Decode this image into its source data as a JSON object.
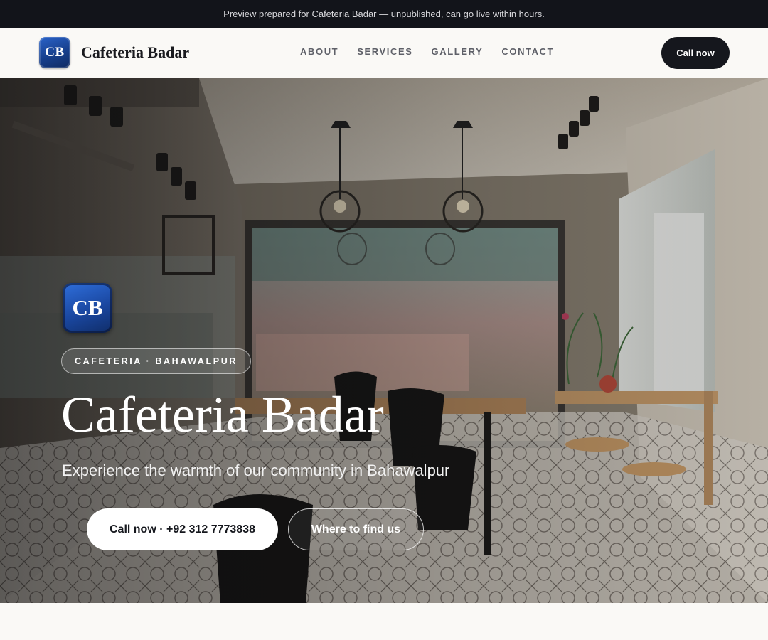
{
  "banner": {
    "text": "Preview prepared for Cafeteria Badar — unpublished, can go live within hours."
  },
  "header": {
    "logo_initials": "CB",
    "brand": "Cafeteria Badar",
    "nav": [
      "ABOUT",
      "SERVICES",
      "GALLERY",
      "CONTACT"
    ],
    "call_label": "Call now"
  },
  "hero": {
    "logo_initials": "CB",
    "eyebrow": "CAFETERIA · BAHAWALPUR",
    "title": "Cafeteria Badar",
    "subtitle": "Experience the warmth of our community in Bahawalpur",
    "primary_cta": "Call now · +92 312 7773838",
    "secondary_cta": "Where to find us",
    "background_image": "cafe-interior-photo"
  },
  "colors": {
    "banner_bg": "#12141a",
    "header_bg": "#faf9f6",
    "dark_button": "#15171d",
    "logo_blue": "#1a47a0"
  }
}
